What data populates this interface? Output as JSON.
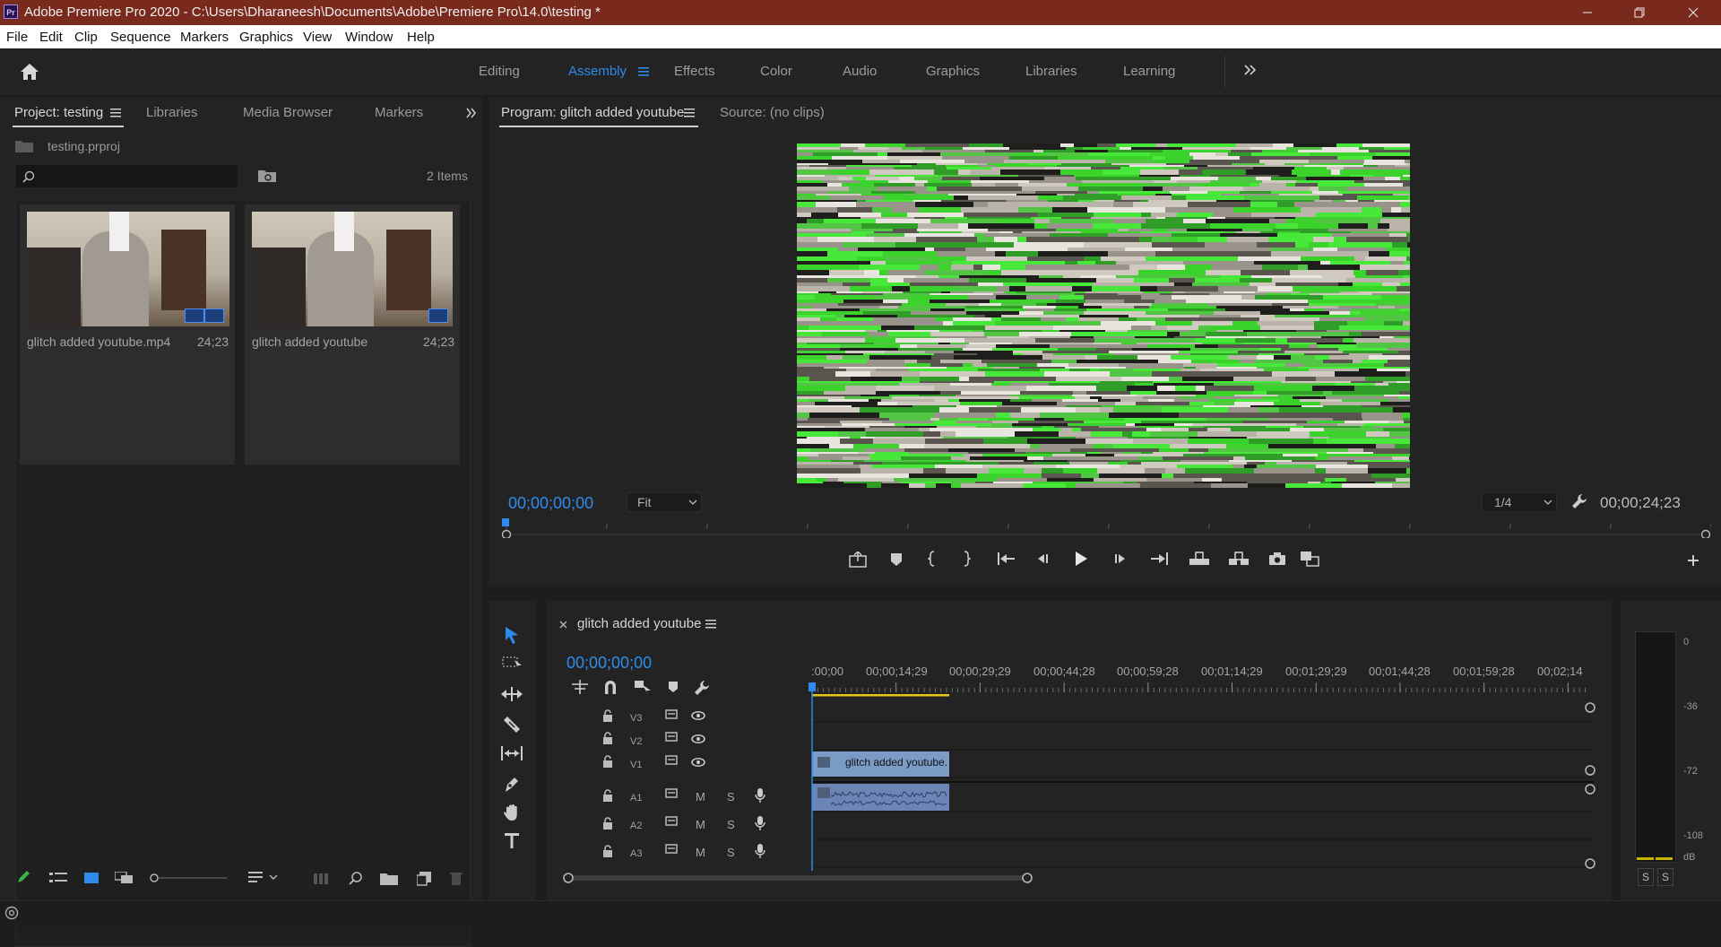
{
  "window": {
    "title": "Adobe Premiere Pro 2020 - C:\\Users\\Dharaneesh\\Documents\\Adobe\\Premiere Pro\\14.0\\testing *",
    "logo_text": "Pr"
  },
  "menu": [
    "File",
    "Edit",
    "Clip",
    "Sequence",
    "Markers",
    "Graphics",
    "View",
    "Window",
    "Help"
  ],
  "workspaces": [
    "Editing",
    "Assembly",
    "Effects",
    "Color",
    "Audio",
    "Graphics",
    "Libraries",
    "Learning"
  ],
  "workspace_active": "Assembly",
  "project_panel": {
    "tabs": [
      "Project: testing",
      "Libraries",
      "Media Browser",
      "Markers"
    ],
    "file_name": "testing.prproj",
    "search_placeholder": "",
    "item_count": "2 Items",
    "items": [
      {
        "name": "glitch added youtube.mp4",
        "duration": "24;23"
      },
      {
        "name": "glitch added youtube",
        "duration": "24;23"
      }
    ]
  },
  "program_monitor": {
    "tab": "Program: glitch added youtube",
    "source_tab": "Source: (no clips)",
    "current_time": "00;00;00;00",
    "zoom": "Fit",
    "resolution": "1/4",
    "duration": "00;00;24;23"
  },
  "timeline": {
    "sequence_name": "glitch added youtube",
    "current_time": "00;00;00;00",
    "ruler_labels": [
      ":00;00",
      "00;00;14;29",
      "00;00;29;29",
      "00;00;44;28",
      "00;00;59;28",
      "00;01;14;29",
      "00;01;29;29",
      "00;01;44;28",
      "00;01;59;28",
      "00;02;14"
    ],
    "video_tracks": [
      "V3",
      "V2",
      "V1"
    ],
    "audio_tracks": [
      "A1",
      "A2",
      "A3"
    ],
    "clip_label": "glitch added youtube.",
    "mute_label": "M",
    "solo_label": "S"
  },
  "audio_meter": {
    "labels": [
      "0",
      "-36",
      "-72",
      "-108",
      "dB"
    ],
    "solo_buttons": [
      "S",
      "S"
    ]
  },
  "colors": {
    "accent_blue": "#2d8ceb",
    "title_bar": "#7a2a1c",
    "clip_video": "#7b9bc7",
    "clip_audio": "#6b86b6",
    "work_area_yellow": "#e0c619"
  }
}
